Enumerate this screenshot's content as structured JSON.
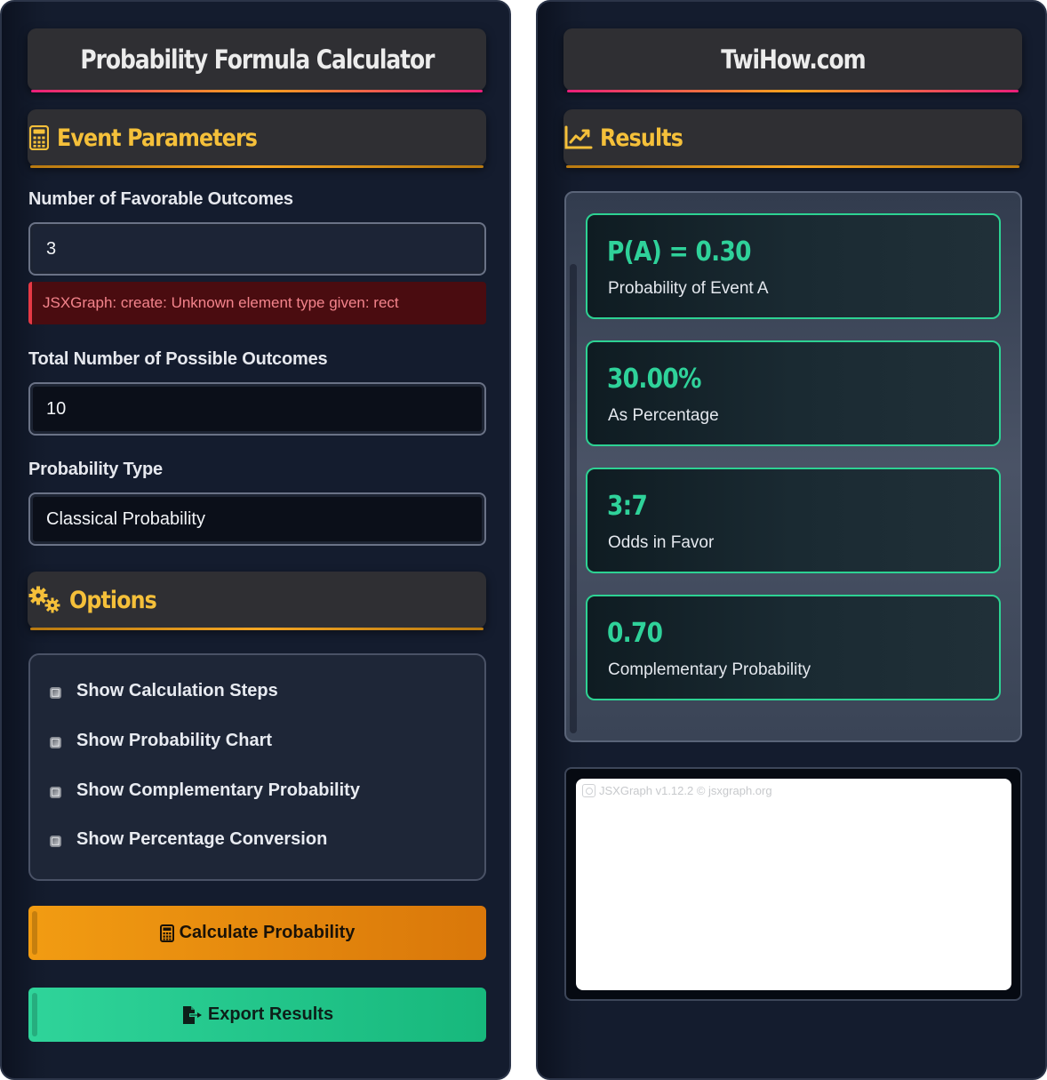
{
  "left_panel": {
    "title": "Probability Formula Calculator",
    "event_section": {
      "title": "Event Parameters",
      "icon": "calculator-icon"
    },
    "favorable": {
      "label": "Number of Favorable Outcomes",
      "value": "3"
    },
    "error_message": "JSXGraph: create: Unknown element type given: rect",
    "total": {
      "label": "Total Number of Possible Outcomes",
      "value": "10"
    },
    "prob_type": {
      "label": "Probability Type",
      "value": "Classical Probability"
    },
    "options_section": {
      "title": "Options",
      "icon": "gears-icon"
    },
    "options": [
      {
        "label": "Show Calculation Steps"
      },
      {
        "label": "Show Probability Chart"
      },
      {
        "label": "Show Complementary Probability"
      },
      {
        "label": "Show Percentage Conversion"
      }
    ],
    "calculate_button": {
      "label": "Calculate Probability",
      "icon": "calculator-icon",
      "color": "#f29c12"
    },
    "export_button": {
      "label": "Export Results",
      "icon": "file-export-icon",
      "color": "#2fd49a"
    }
  },
  "right_panel": {
    "title": "TwiHow.com",
    "results_section": {
      "title": "Results",
      "icon": "chart-line-icon"
    },
    "results": [
      {
        "value": "P(A) = 0.30",
        "label": "Probability of Event A"
      },
      {
        "value": "30.00%",
        "label": "As Percentage"
      },
      {
        "value": "3:7",
        "label": "Odds in Favor"
      },
      {
        "value": "0.70",
        "label": "Complementary Probability"
      }
    ],
    "graph_credit": "JSXGraph v1.12.2 © jsxgraph.org"
  },
  "colors": {
    "accent_orange": "#f5c03a",
    "accent_green": "#2fd29a",
    "error_red": "#e53945"
  }
}
